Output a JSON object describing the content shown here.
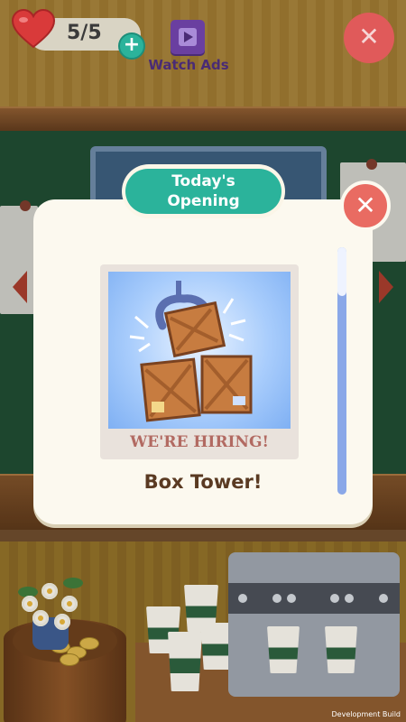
{
  "hud": {
    "lives": "5/5",
    "watch_ads_label": "Watch Ads"
  },
  "modal": {
    "title": "Today's Opening",
    "poster_caption": "WE'RE HIRING!",
    "item_name": "Box Tower!"
  },
  "footer": {
    "build_label": "Development Build"
  },
  "icons": {
    "heart": "heart-icon",
    "plus": "plus-icon",
    "watch_ads": "video-icon",
    "close": "close-icon"
  },
  "colors": {
    "accent_teal": "#2bb39b",
    "close_red": "#e96b62",
    "modal_bg": "#fcf9ef",
    "title_text": "#5a3a22",
    "hiring_text": "#b26a62"
  }
}
